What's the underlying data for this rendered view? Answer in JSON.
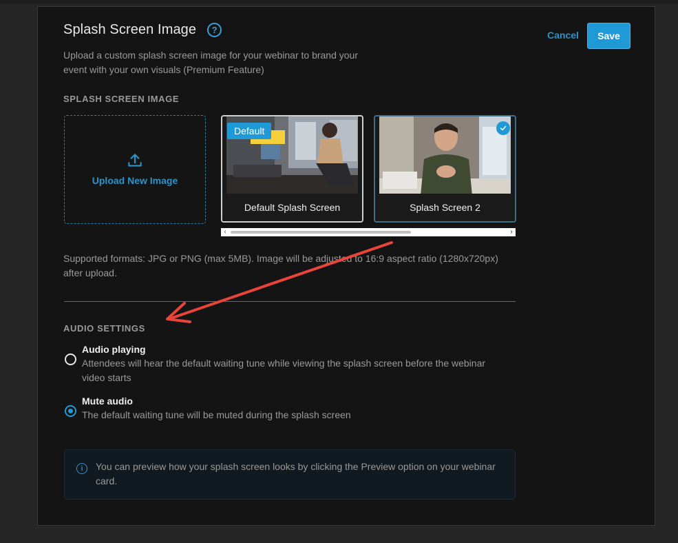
{
  "header": {
    "title": "Splash Screen Image",
    "subtitle": "Upload a custom splash screen image for your webinar to brand your event with your own visuals (Premium Feature)",
    "cancel_label": "Cancel",
    "save_label": "Save"
  },
  "splash_section": {
    "label": "SPLASH SCREEN IMAGE",
    "upload_label": "Upload New Image",
    "thumbnails": [
      {
        "caption": "Default Splash Screen",
        "badge": "Default",
        "selected": false
      },
      {
        "caption": "Splash Screen 2",
        "badge": "",
        "selected": true
      }
    ],
    "formats_text": "Supported formats: JPG or PNG (max 5MB). Image will be adjusted to 16:9 aspect ratio (1280x720px) after upload."
  },
  "audio_section": {
    "label": "AUDIO SETTINGS",
    "options": [
      {
        "title": "Audio playing",
        "description": "Attendees will hear the default waiting tune while viewing the splash screen before the webinar video starts",
        "selected": false
      },
      {
        "title": "Mute audio",
        "description": "The default waiting tune will be muted during the splash screen",
        "selected": true
      }
    ]
  },
  "info": {
    "text": "You can preview how your splash screen looks by clicking the Preview option on your webinar card."
  },
  "icons": {
    "help": "question-circle-icon",
    "upload": "upload-icon",
    "check": "check-icon",
    "info": "info-circle-icon"
  },
  "colors": {
    "accent": "#1f9ad6",
    "annotation_arrow": "#e8443a"
  }
}
